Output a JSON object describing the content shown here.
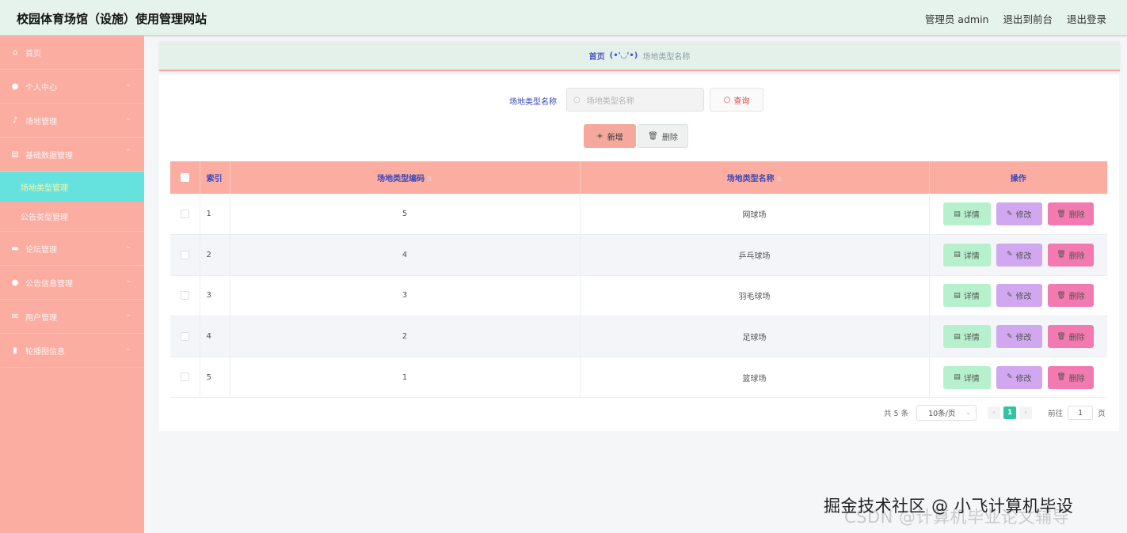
{
  "header": {
    "title": "校园体育场馆（设施）使用管理网站",
    "admin_label": "管理员 admin",
    "back_front": "退出到前台",
    "logout": "退出登录"
  },
  "sidebar": {
    "items": [
      {
        "label": "首页",
        "icon": "home-icon"
      },
      {
        "label": "个人中心",
        "icon": "user-icon"
      },
      {
        "label": "场地管理",
        "icon": "mic-icon"
      },
      {
        "label": "基础数据管理",
        "icon": "document-icon"
      },
      {
        "label": "场地类型管理"
      },
      {
        "label": "公告类型管理"
      },
      {
        "label": "论坛管理",
        "icon": "briefcase-icon"
      },
      {
        "label": "公告信息管理",
        "icon": "location-icon"
      },
      {
        "label": "用户管理",
        "icon": "mail-icon"
      },
      {
        "label": "轮播图信息",
        "icon": "chart-icon"
      }
    ]
  },
  "breadcrumb": {
    "home": "首页",
    "face": "(•'◡'•)",
    "current": "场地类型名称"
  },
  "search": {
    "label": "场地类型名称",
    "placeholder": "场地类型名称",
    "query_button": "查询"
  },
  "actions": {
    "add": "新增",
    "delete": "删除"
  },
  "table": {
    "headers": {
      "index": "索引",
      "code": "场地类型编码",
      "name": "场地类型名称",
      "ops": "操作"
    },
    "rows": [
      {
        "index": "1",
        "code": "5",
        "name": "网球场"
      },
      {
        "index": "2",
        "code": "4",
        "name": "乒乓球场"
      },
      {
        "index": "3",
        "code": "3",
        "name": "羽毛球场"
      },
      {
        "index": "4",
        "code": "2",
        "name": "足球场"
      },
      {
        "index": "5",
        "code": "1",
        "name": "篮球场"
      }
    ],
    "row_buttons": {
      "detail": "详情",
      "edit": "修改",
      "delete": "删除"
    }
  },
  "pagination": {
    "total": "共 5 条",
    "page_size": "10条/页",
    "current_page": "1",
    "goto_label": "前往",
    "goto_value": "1",
    "page_suffix": "页"
  },
  "watermark": {
    "line1": "掘金技术社区 @ 小飞计算机毕设",
    "line2": "CSDN @计算机毕业论文辅导"
  },
  "colors": {
    "sidebar": "#fbada2",
    "active_menu": "#66e2de",
    "header": "#e6f2ec",
    "detail_btn": "#b6f0cc",
    "edit_btn": "#d1a7ef",
    "delete_btn": "#f27ab0"
  }
}
